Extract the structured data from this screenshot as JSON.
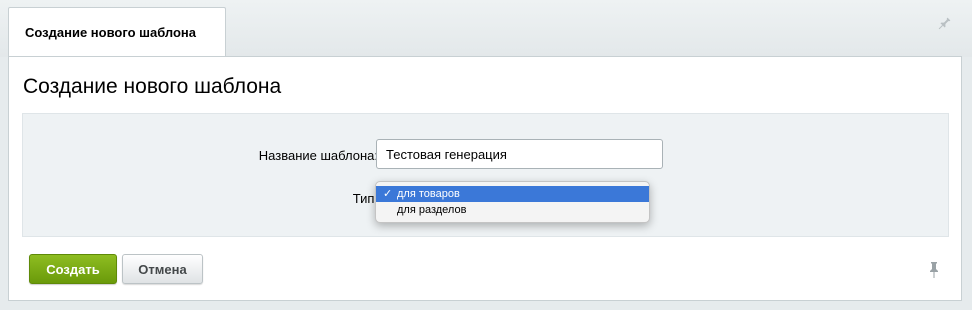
{
  "tab": {
    "label": "Создание нового шаблона"
  },
  "page": {
    "title": "Создание нового шаблона"
  },
  "form": {
    "name_label": "Название шаблона:",
    "name_value": "Тестовая генерация",
    "type_label": "Тип:",
    "type_options": [
      {
        "label": "для товаров",
        "selected": true,
        "check": "✓"
      },
      {
        "label": "для разделов",
        "selected": false
      }
    ]
  },
  "buttons": {
    "create_label": "Создать",
    "cancel_label": "Отмена"
  },
  "icons": {
    "top": "pin-icon",
    "bottom": "pin-icon"
  },
  "colors": {
    "accent_green": "#7aab14",
    "selection_blue": "#3b78d8"
  }
}
